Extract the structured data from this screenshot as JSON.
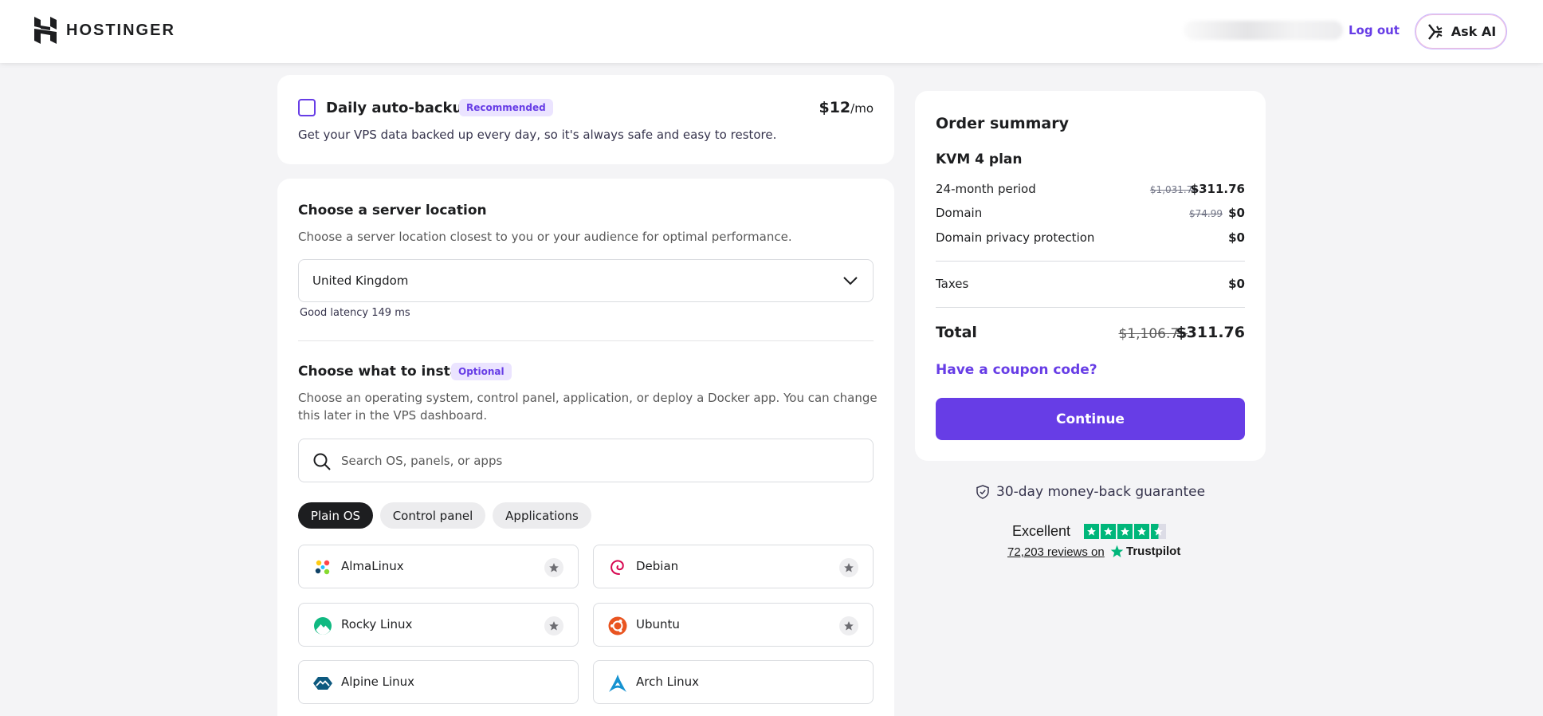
{
  "header": {
    "brand": "HOSTINGER",
    "logout_label": "Log out",
    "ask_ai_label": "Ask AI"
  },
  "backup": {
    "title": "Daily auto-backup",
    "badge": "Recommended",
    "price": "$12",
    "price_unit": "/mo",
    "description": "Get your VPS data backed up every day, so it's always safe and easy to restore.",
    "checked": false
  },
  "location": {
    "title": "Choose a server location",
    "description": "Choose a server location closest to you or your audience for optimal performance.",
    "selected": "United Kingdom",
    "latency": "Good latency 149 ms"
  },
  "install": {
    "title": "Choose what to install",
    "badge": "Optional",
    "description": "Choose an operating system, control panel, application, or deploy a Docker app. You can change this later in the VPS dashboard.",
    "search_placeholder": "Search OS, panels, or apps",
    "tabs": [
      {
        "label": "Plain OS",
        "active": true
      },
      {
        "label": "Control panel",
        "active": false
      },
      {
        "label": "Applications",
        "active": false
      }
    ],
    "os_options": [
      {
        "name": "AlmaLinux",
        "icon": "almalinux-icon",
        "starred": true
      },
      {
        "name": "Debian",
        "icon": "debian-icon",
        "starred": true
      },
      {
        "name": "Rocky Linux",
        "icon": "rocky-linux-icon",
        "starred": true
      },
      {
        "name": "Ubuntu",
        "icon": "ubuntu-icon",
        "starred": true
      },
      {
        "name": "Alpine Linux",
        "icon": "alpine-linux-icon",
        "starred": false
      },
      {
        "name": "Arch Linux",
        "icon": "arch-linux-icon",
        "starred": false
      }
    ]
  },
  "summary": {
    "title": "Order summary",
    "plan": "KVM 4 plan",
    "lines": [
      {
        "label": "24-month period",
        "old_price": "$1,031.76",
        "price": "$311.76"
      },
      {
        "label": "Domain",
        "old_price": "$74.99",
        "price": "$0"
      },
      {
        "label": "Domain privacy protection",
        "old_price": "",
        "price": "$0"
      }
    ],
    "taxes_label": "Taxes",
    "taxes_price": "$0",
    "total_label": "Total",
    "total_old": "$1,106.75",
    "total_new": "$311.76",
    "coupon_label": "Have a coupon code?",
    "continue_label": "Continue"
  },
  "trust": {
    "guarantee": "30-day money-back guarantee",
    "rating_label": "Excellent",
    "reviews": "72,203 reviews on",
    "trustpilot": "Trustpilot",
    "stars": 4.5
  },
  "colors": {
    "accent": "#673de6",
    "trustpilot_green": "#00b67a"
  }
}
